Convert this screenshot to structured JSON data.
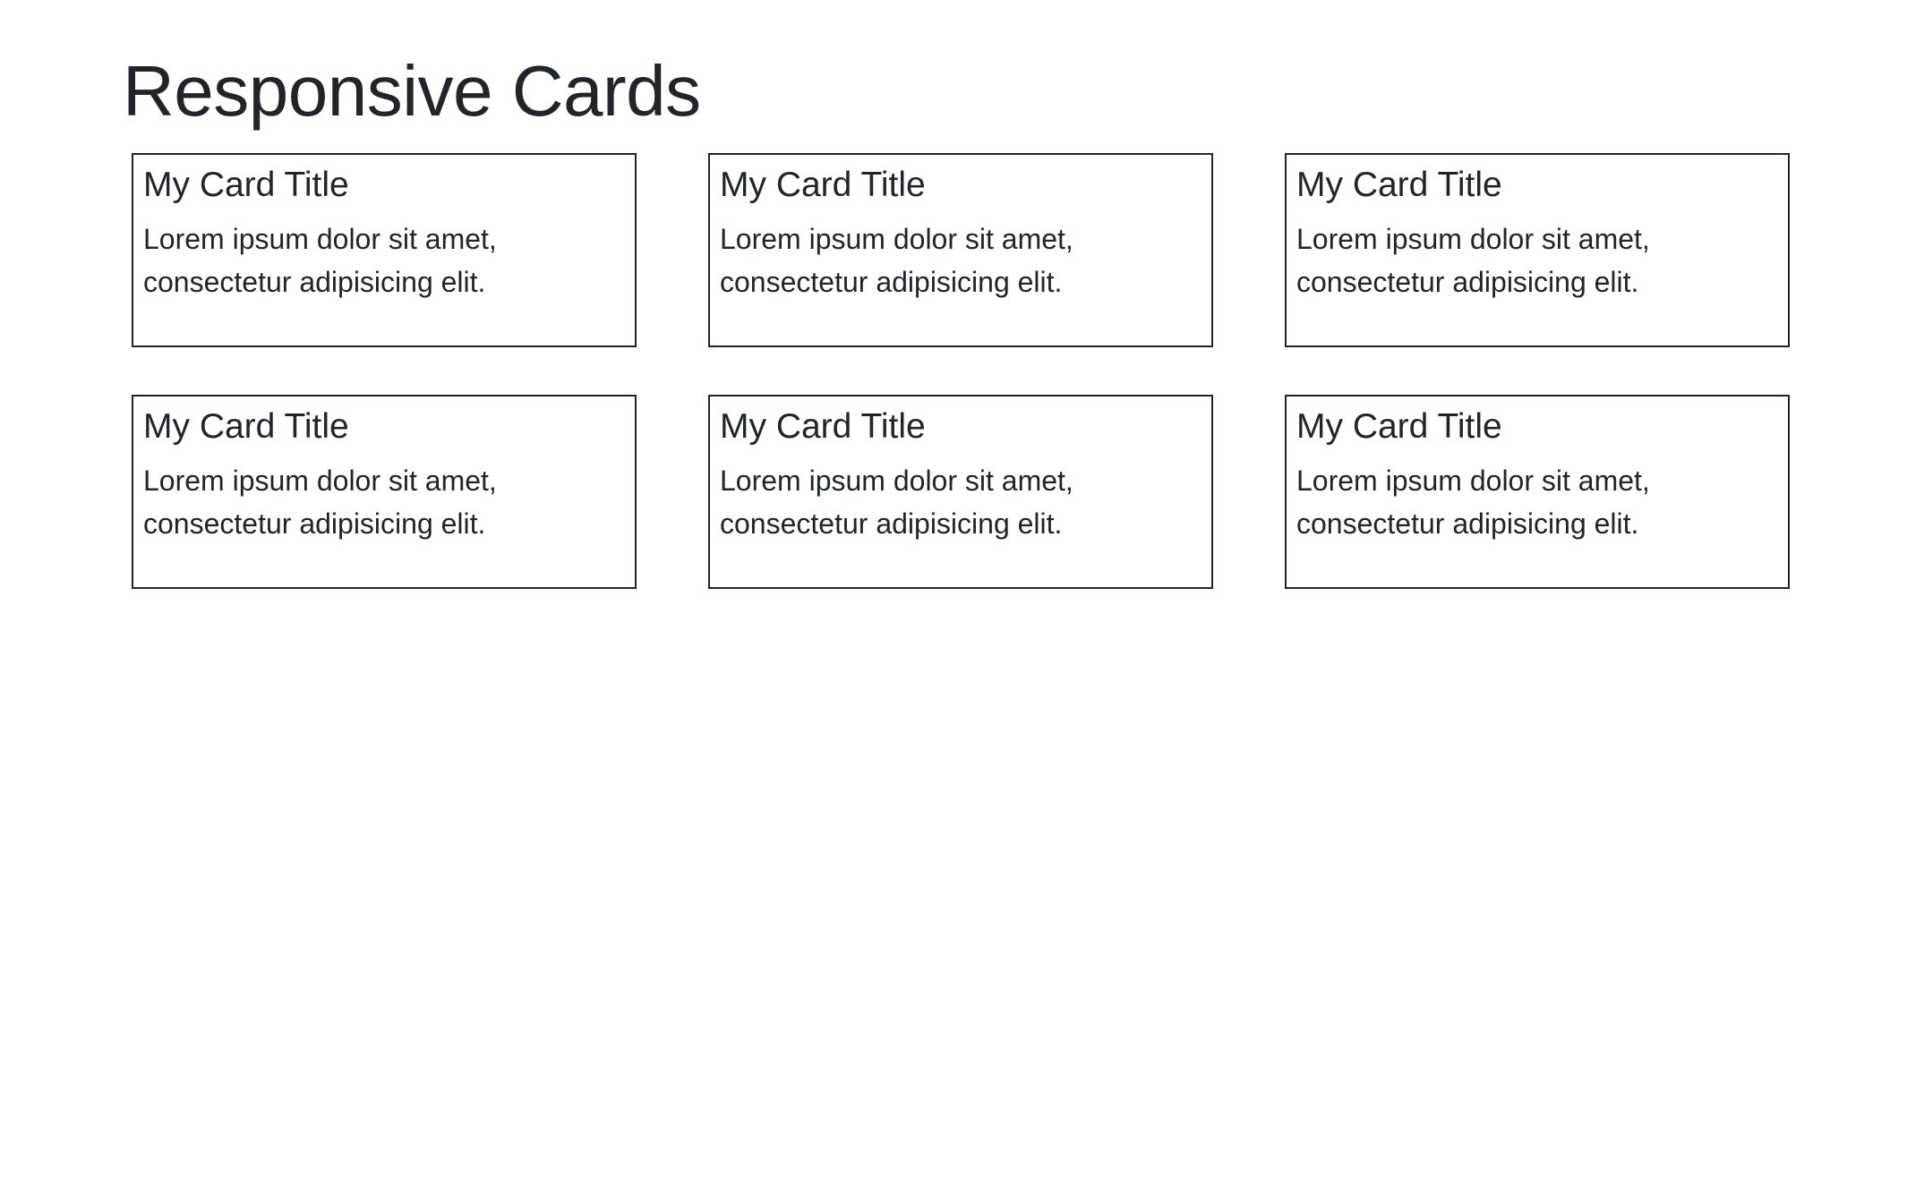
{
  "page": {
    "title": "Responsive Cards"
  },
  "cards": [
    {
      "title": "My Card Title",
      "text": "Lorem ipsum dolor sit amet, consectetur adipisicing elit."
    },
    {
      "title": "My Card Title",
      "text": "Lorem ipsum dolor sit amet, consectetur adipisicing elit."
    },
    {
      "title": "My Card Title",
      "text": "Lorem ipsum dolor sit amet, consectetur adipisicing elit."
    },
    {
      "title": "My Card Title",
      "text": "Lorem ipsum dolor sit amet, consectetur adipisicing elit."
    },
    {
      "title": "My Card Title",
      "text": "Lorem ipsum dolor sit amet, consectetur adipisicing elit."
    },
    {
      "title": "My Card Title",
      "text": "Lorem ipsum dolor sit amet, consectetur adipisicing elit."
    }
  ],
  "colors": {
    "text": "#212529",
    "border": "#212529",
    "background": "#ffffff"
  }
}
